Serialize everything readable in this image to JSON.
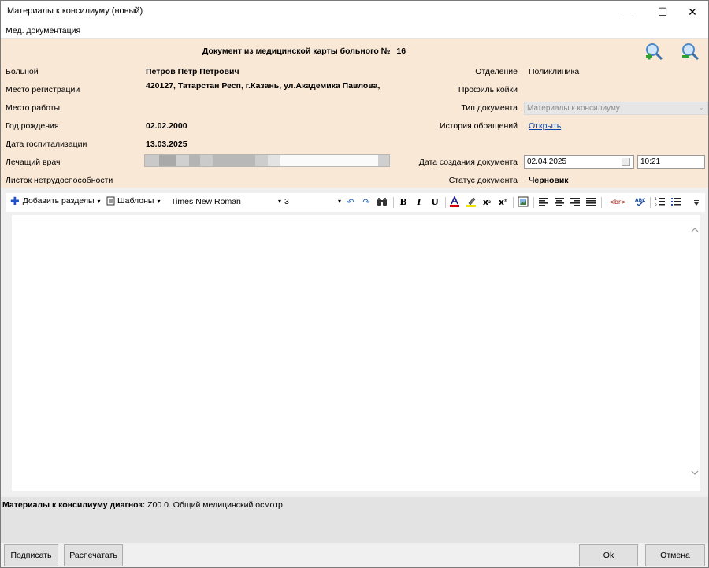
{
  "window": {
    "title": "Материалы к консилиуму (новый)",
    "controls": {
      "minimize": "—",
      "maximize": "☐",
      "close": "✕"
    }
  },
  "menu": {
    "items": [
      "Мед. документация"
    ]
  },
  "header": {
    "doc_title": "Документ из медицинской карты больного №",
    "doc_number": "16",
    "zoom_in_icon": "zoom-in-icon",
    "zoom_out_icon": "zoom-out-icon",
    "left_fields": [
      {
        "label": "Больной",
        "value": "Петров Петр Петрович"
      },
      {
        "label": "Место регистрации",
        "value": "420127, Татарстан Респ, г.Казань, ул.Академика Павлова,"
      },
      {
        "label": "Место работы",
        "value": ""
      },
      {
        "label": "Год рождения",
        "value": "02.02.2000"
      },
      {
        "label": "Дата госпитализации",
        "value": "13.03.2025"
      },
      {
        "label": "Лечащий врач",
        "value": ""
      },
      {
        "label": "Листок нетрудоспособности",
        "value": ""
      }
    ],
    "right_fields": {
      "department_label": "Отделение",
      "department_value": "Поликлиника",
      "bed_profile_label": "Профиль койки",
      "doc_type_label": "Тип документа",
      "doc_type_value": "Материалы к консилиуму",
      "history_label": "История обращений",
      "history_link": "Открыть",
      "created_label": "Дата создания документа",
      "created_date": "02.04.2025",
      "created_time": "10:21",
      "status_label": "Статус документа",
      "status_value": "Черновик"
    }
  },
  "toolbar": {
    "add_sections": "Добавить разделы",
    "templates": "Шаблоны",
    "font_name": "Times New Roman",
    "font_size": "3",
    "dropdown_glyph": "▾",
    "bold": "B",
    "italic": "I",
    "underline": "U",
    "br_tag": "<br>"
  },
  "diagnosis": {
    "label": "Материалы к консилиуму диагноз:",
    "value": "Z00.0. Общий медицинский осмотр"
  },
  "buttons": {
    "sign": "Подписать",
    "print": "Распечатать",
    "ok": "Ok",
    "cancel": "Отмена"
  }
}
